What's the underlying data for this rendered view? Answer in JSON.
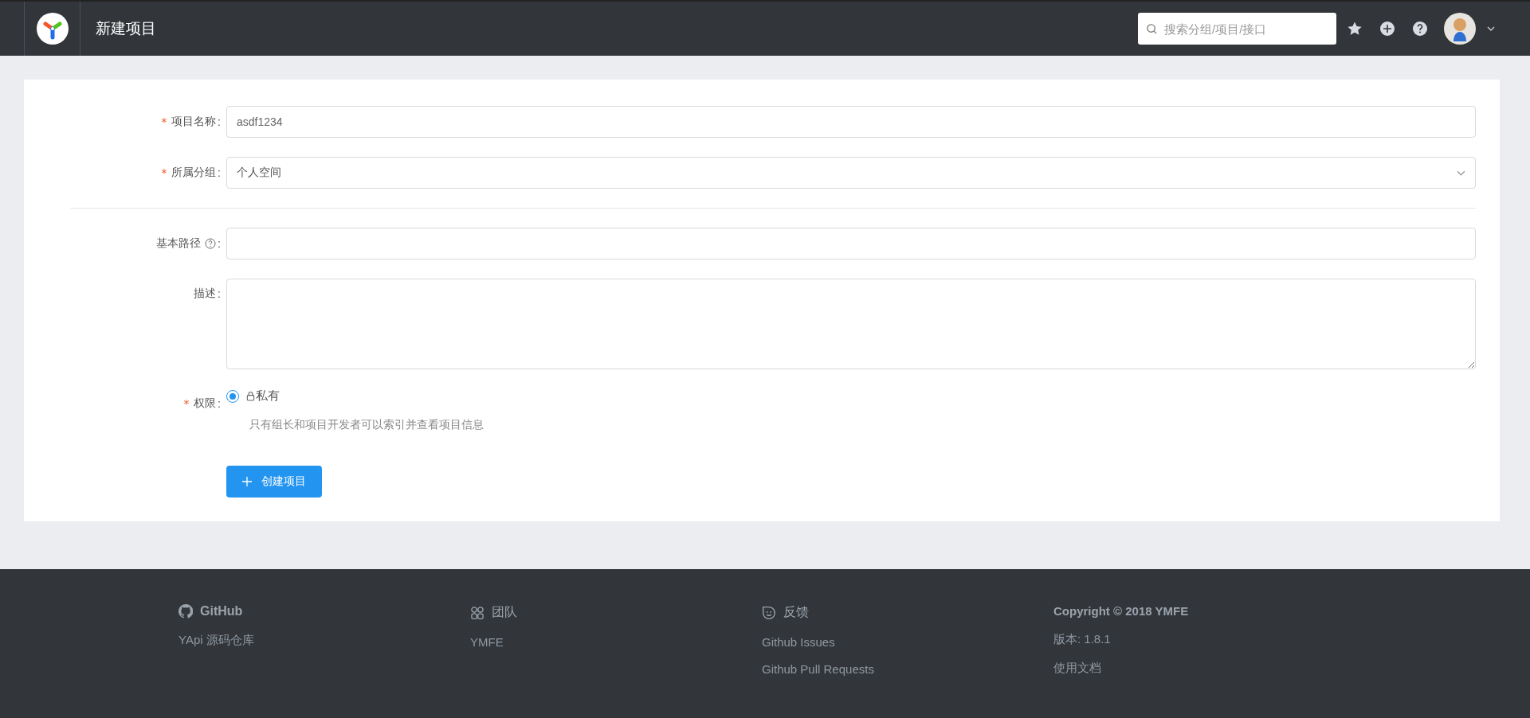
{
  "header": {
    "title": "新建项目",
    "search": {
      "placeholder": "搜索分组/项目/接口"
    }
  },
  "form": {
    "fields": [
      {
        "kind": "input",
        "mark": "*",
        "label": "项目名称",
        "colon": ":",
        "value": "asdf1234"
      },
      {
        "kind": "select",
        "mark": "*",
        "label": "所属分组",
        "colon": ":",
        "value": "个人空间"
      },
      {
        "kind": "divider"
      },
      {
        "kind": "input",
        "label": "基本路径",
        "help": true,
        "colon": ":"
      },
      {
        "kind": "textarea",
        "label": "描述",
        "colon": ":"
      },
      {
        "kind": "radio",
        "mark": "*",
        "label": "权限",
        "colon": ":",
        "options": [
          {
            "label": "私有",
            "selected": true,
            "hint": "只有组长和项目开发者可以索引并查看项目信息"
          }
        ]
      }
    ],
    "submit": "创建项目"
  },
  "footer": {
    "columns": [
      {
        "kind": "github",
        "title": "GitHub",
        "links": [
          "YApi 源码仓库"
        ]
      },
      {
        "kind": "team",
        "title": "团队",
        "links": [
          "YMFE"
        ]
      },
      {
        "kind": "feedback",
        "title": "反馈",
        "links": [
          "Github Issues",
          "Github Pull Requests"
        ]
      },
      {
        "kind": "plain",
        "title": "Copyright © 2018 YMFE",
        "links": [
          "版本: 1.8.1",
          "使用文档"
        ]
      }
    ]
  }
}
